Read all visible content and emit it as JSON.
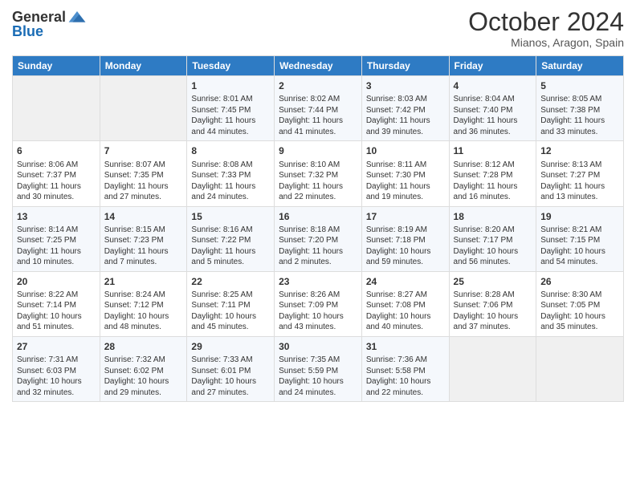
{
  "header": {
    "logo_general": "General",
    "logo_blue": "Blue",
    "month_title": "October 2024",
    "location": "Mianos, Aragon, Spain"
  },
  "weekdays": [
    "Sunday",
    "Monday",
    "Tuesday",
    "Wednesday",
    "Thursday",
    "Friday",
    "Saturday"
  ],
  "weeks": [
    [
      {
        "day": "",
        "info": ""
      },
      {
        "day": "",
        "info": ""
      },
      {
        "day": "1",
        "info": "Sunrise: 8:01 AM\nSunset: 7:45 PM\nDaylight: 11 hours and 44 minutes."
      },
      {
        "day": "2",
        "info": "Sunrise: 8:02 AM\nSunset: 7:44 PM\nDaylight: 11 hours and 41 minutes."
      },
      {
        "day": "3",
        "info": "Sunrise: 8:03 AM\nSunset: 7:42 PM\nDaylight: 11 hours and 39 minutes."
      },
      {
        "day": "4",
        "info": "Sunrise: 8:04 AM\nSunset: 7:40 PM\nDaylight: 11 hours and 36 minutes."
      },
      {
        "day": "5",
        "info": "Sunrise: 8:05 AM\nSunset: 7:38 PM\nDaylight: 11 hours and 33 minutes."
      }
    ],
    [
      {
        "day": "6",
        "info": "Sunrise: 8:06 AM\nSunset: 7:37 PM\nDaylight: 11 hours and 30 minutes."
      },
      {
        "day": "7",
        "info": "Sunrise: 8:07 AM\nSunset: 7:35 PM\nDaylight: 11 hours and 27 minutes."
      },
      {
        "day": "8",
        "info": "Sunrise: 8:08 AM\nSunset: 7:33 PM\nDaylight: 11 hours and 24 minutes."
      },
      {
        "day": "9",
        "info": "Sunrise: 8:10 AM\nSunset: 7:32 PM\nDaylight: 11 hours and 22 minutes."
      },
      {
        "day": "10",
        "info": "Sunrise: 8:11 AM\nSunset: 7:30 PM\nDaylight: 11 hours and 19 minutes."
      },
      {
        "day": "11",
        "info": "Sunrise: 8:12 AM\nSunset: 7:28 PM\nDaylight: 11 hours and 16 minutes."
      },
      {
        "day": "12",
        "info": "Sunrise: 8:13 AM\nSunset: 7:27 PM\nDaylight: 11 hours and 13 minutes."
      }
    ],
    [
      {
        "day": "13",
        "info": "Sunrise: 8:14 AM\nSunset: 7:25 PM\nDaylight: 11 hours and 10 minutes."
      },
      {
        "day": "14",
        "info": "Sunrise: 8:15 AM\nSunset: 7:23 PM\nDaylight: 11 hours and 7 minutes."
      },
      {
        "day": "15",
        "info": "Sunrise: 8:16 AM\nSunset: 7:22 PM\nDaylight: 11 hours and 5 minutes."
      },
      {
        "day": "16",
        "info": "Sunrise: 8:18 AM\nSunset: 7:20 PM\nDaylight: 11 hours and 2 minutes."
      },
      {
        "day": "17",
        "info": "Sunrise: 8:19 AM\nSunset: 7:18 PM\nDaylight: 10 hours and 59 minutes."
      },
      {
        "day": "18",
        "info": "Sunrise: 8:20 AM\nSunset: 7:17 PM\nDaylight: 10 hours and 56 minutes."
      },
      {
        "day": "19",
        "info": "Sunrise: 8:21 AM\nSunset: 7:15 PM\nDaylight: 10 hours and 54 minutes."
      }
    ],
    [
      {
        "day": "20",
        "info": "Sunrise: 8:22 AM\nSunset: 7:14 PM\nDaylight: 10 hours and 51 minutes."
      },
      {
        "day": "21",
        "info": "Sunrise: 8:24 AM\nSunset: 7:12 PM\nDaylight: 10 hours and 48 minutes."
      },
      {
        "day": "22",
        "info": "Sunrise: 8:25 AM\nSunset: 7:11 PM\nDaylight: 10 hours and 45 minutes."
      },
      {
        "day": "23",
        "info": "Sunrise: 8:26 AM\nSunset: 7:09 PM\nDaylight: 10 hours and 43 minutes."
      },
      {
        "day": "24",
        "info": "Sunrise: 8:27 AM\nSunset: 7:08 PM\nDaylight: 10 hours and 40 minutes."
      },
      {
        "day": "25",
        "info": "Sunrise: 8:28 AM\nSunset: 7:06 PM\nDaylight: 10 hours and 37 minutes."
      },
      {
        "day": "26",
        "info": "Sunrise: 8:30 AM\nSunset: 7:05 PM\nDaylight: 10 hours and 35 minutes."
      }
    ],
    [
      {
        "day": "27",
        "info": "Sunrise: 7:31 AM\nSunset: 6:03 PM\nDaylight: 10 hours and 32 minutes."
      },
      {
        "day": "28",
        "info": "Sunrise: 7:32 AM\nSunset: 6:02 PM\nDaylight: 10 hours and 29 minutes."
      },
      {
        "day": "29",
        "info": "Sunrise: 7:33 AM\nSunset: 6:01 PM\nDaylight: 10 hours and 27 minutes."
      },
      {
        "day": "30",
        "info": "Sunrise: 7:35 AM\nSunset: 5:59 PM\nDaylight: 10 hours and 24 minutes."
      },
      {
        "day": "31",
        "info": "Sunrise: 7:36 AM\nSunset: 5:58 PM\nDaylight: 10 hours and 22 minutes."
      },
      {
        "day": "",
        "info": ""
      },
      {
        "day": "",
        "info": ""
      }
    ]
  ]
}
